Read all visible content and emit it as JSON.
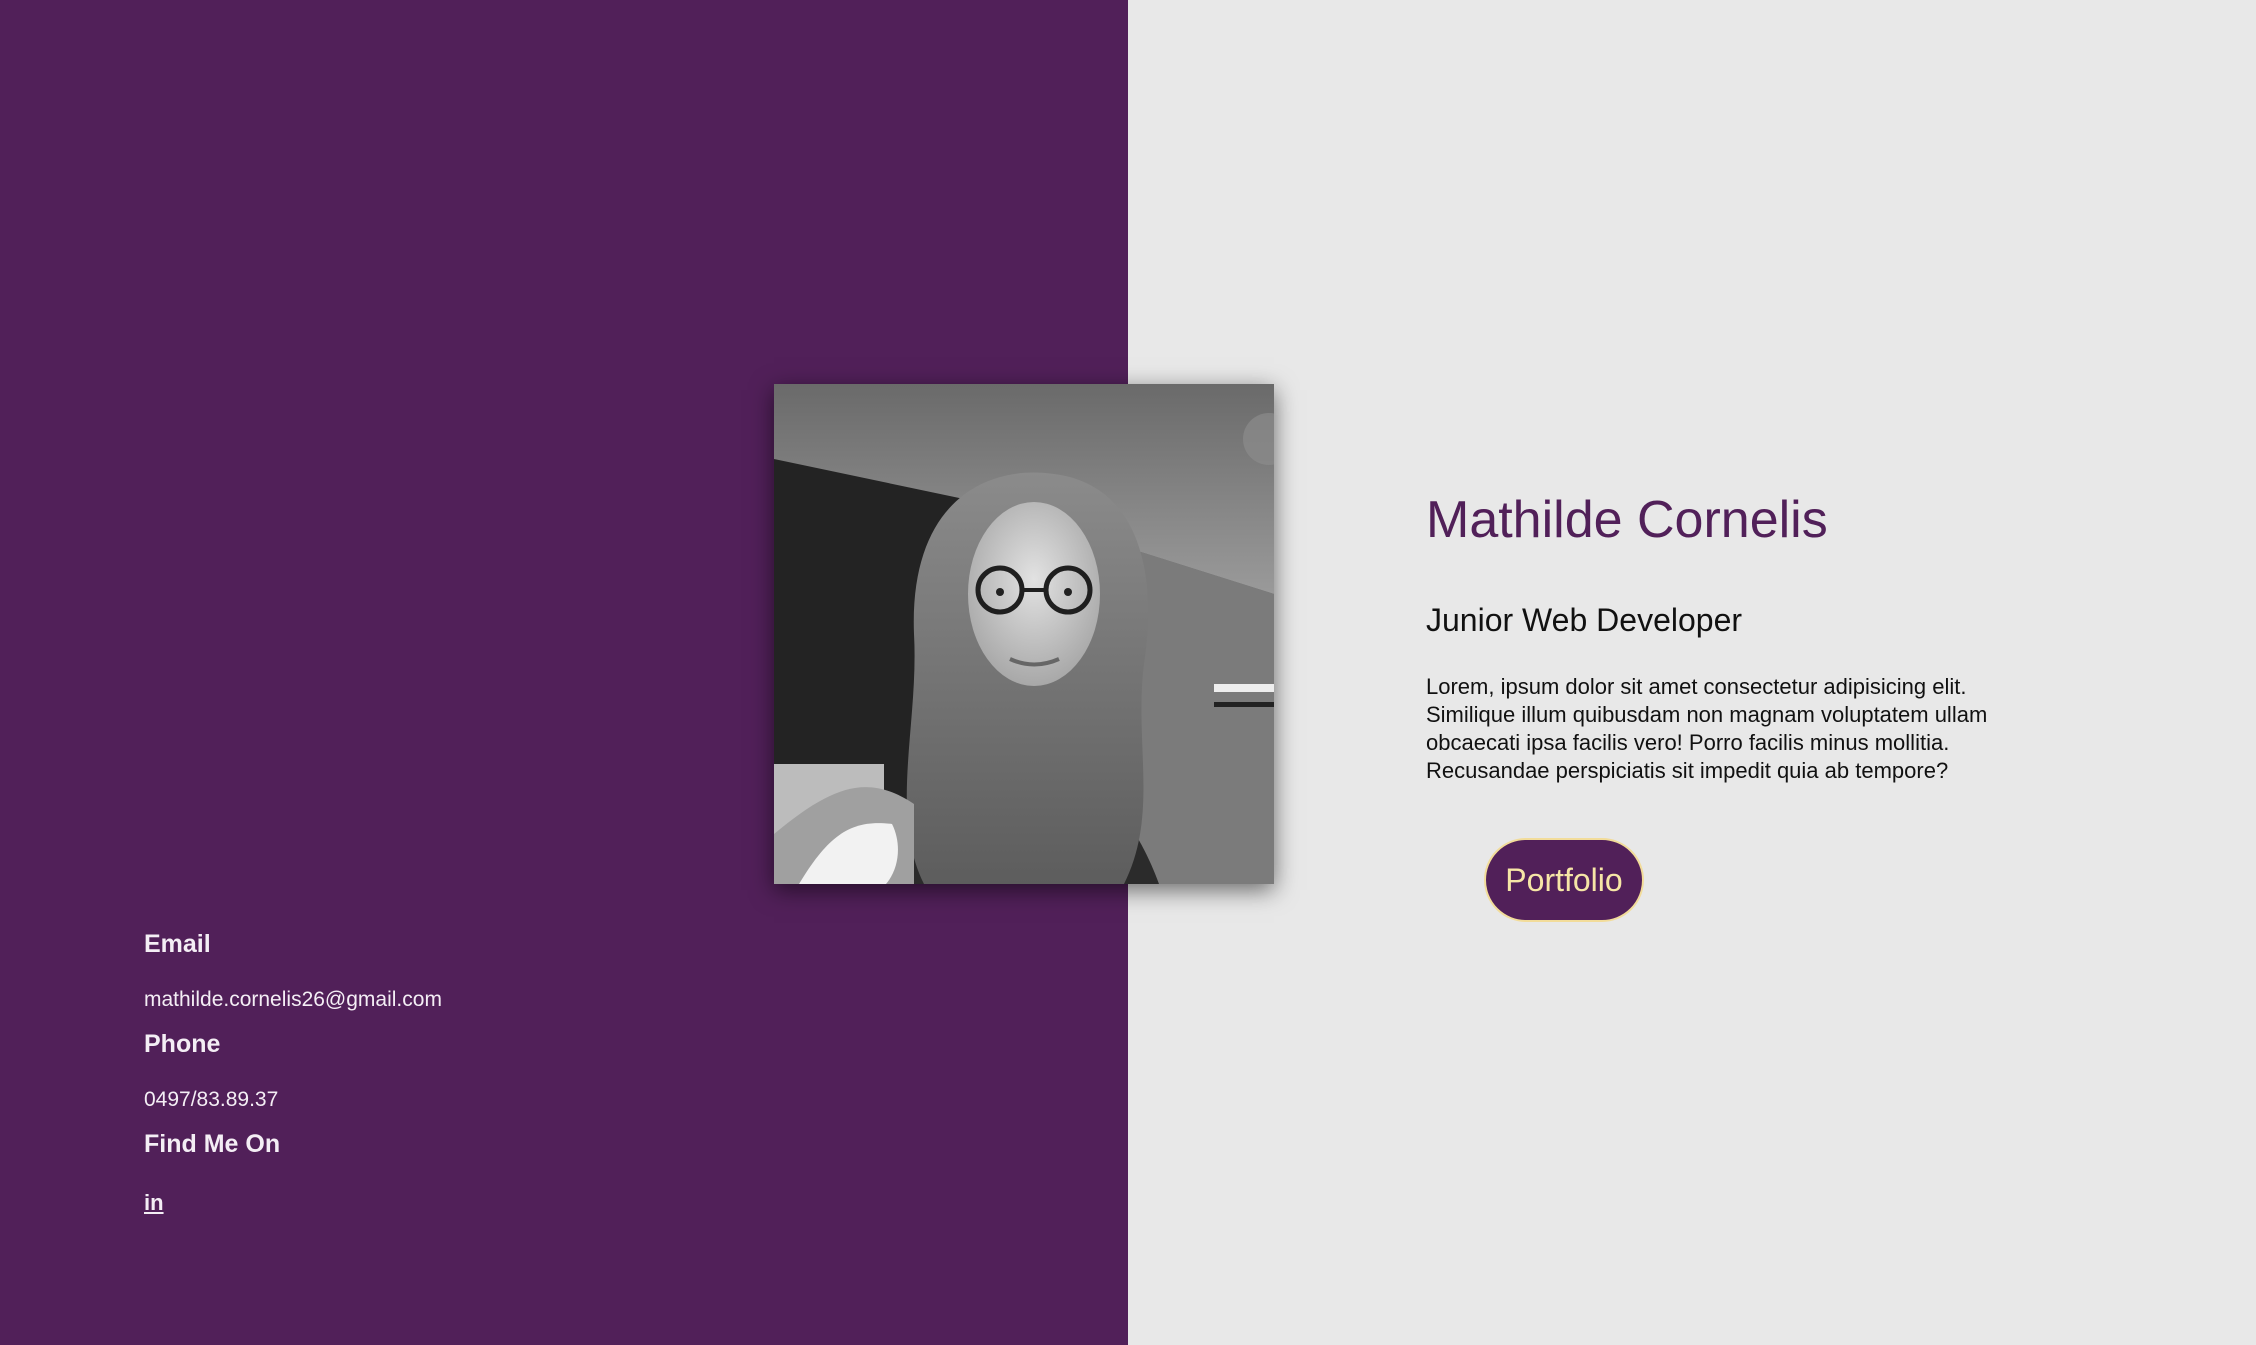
{
  "profile": {
    "name": "Mathilde Cornelis",
    "role": "Junior Web Developer",
    "bio": "Lorem, ipsum dolor sit amet consectetur adipisicing elit. Similique illum quibusdam non magnam voluptatem ullam obcaecati ipsa facilis vero! Porro facilis minus mollitia. Recusandae perspiciatis sit impedit quia ab tempore?",
    "photo_style": "grayscale portrait"
  },
  "actions": {
    "portfolio_label": "Portfolio"
  },
  "contact": {
    "email_heading": "Email",
    "email_value": "mathilde.cornelis26@gmail.com",
    "phone_heading": "Phone",
    "phone_value": "0497/83.89.37",
    "social_heading": "Find Me On",
    "social_icon": "linkedin-icon",
    "social_icon_text": "in"
  },
  "colors": {
    "left_background": "#512059",
    "right_background": "#e8e8e8",
    "name_color": "#512059",
    "button_background": "#512059",
    "button_text": "#f6e6a6",
    "button_border": "#f2dc9a"
  }
}
